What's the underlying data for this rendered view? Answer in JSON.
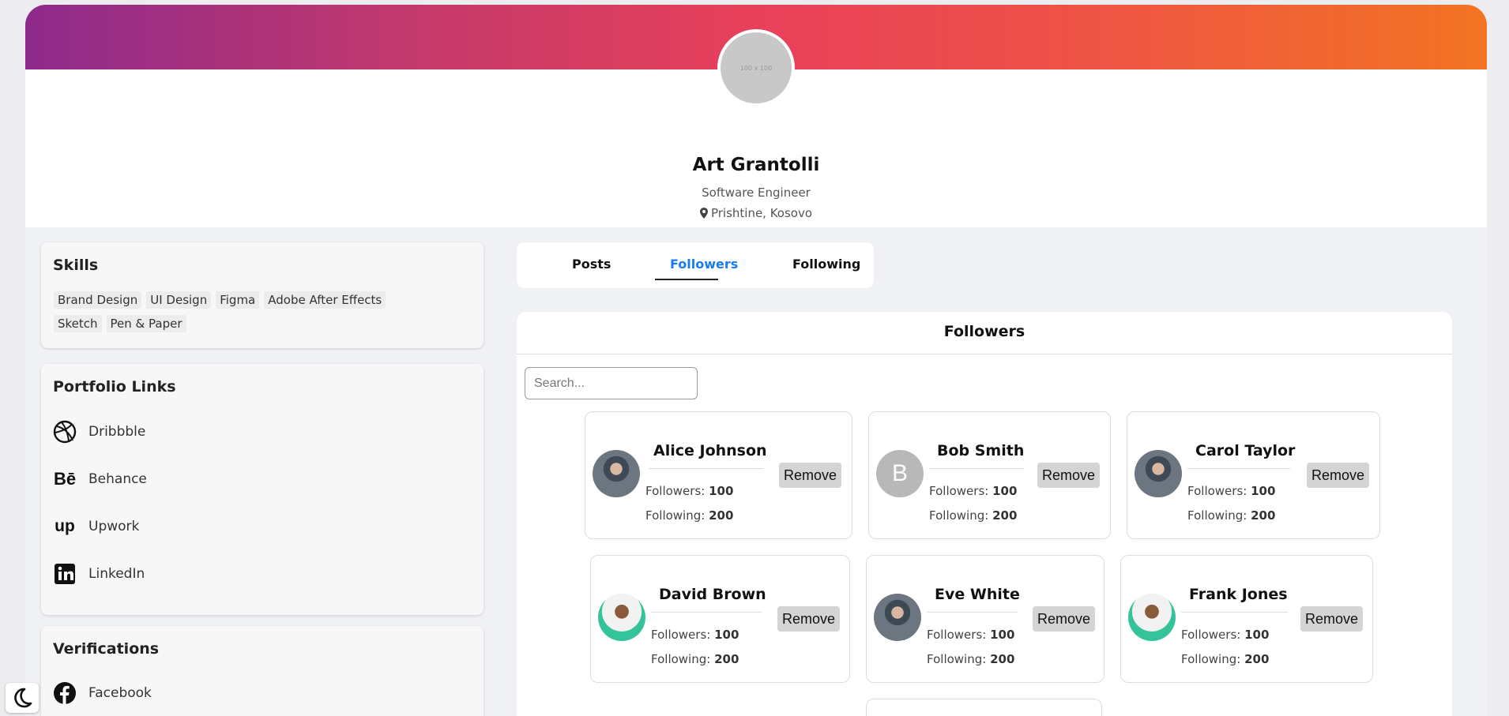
{
  "profile": {
    "avatar_placeholder": "100 x 100",
    "name": "Art Grantolli",
    "title": "Software Engineer",
    "location": "Prishtine, Kosovo"
  },
  "skills": {
    "heading": "Skills",
    "items": [
      "Brand Design",
      "UI Design",
      "Figma",
      "Adobe After Effects",
      "Sketch",
      "Pen & Paper"
    ]
  },
  "portfolio": {
    "heading": "Portfolio Links",
    "links": [
      {
        "label": "Dribbble",
        "icon": "dribbble-icon"
      },
      {
        "label": "Behance",
        "icon": "behance-icon"
      },
      {
        "label": "Upwork",
        "icon": "upwork-icon"
      },
      {
        "label": "LinkedIn",
        "icon": "linkedin-icon"
      }
    ]
  },
  "verifications": {
    "heading": "Verifications",
    "links": [
      {
        "label": "Facebook",
        "icon": "facebook-icon"
      }
    ]
  },
  "tabs": [
    {
      "label": "Posts",
      "active": false
    },
    {
      "label": "Followers",
      "active": true
    },
    {
      "label": "Following",
      "active": false
    }
  ],
  "followers": {
    "heading": "Followers",
    "search_placeholder": "Search...",
    "followers_label": "Followers:",
    "following_label": "Following:",
    "remove_label": "Remove",
    "cards": [
      {
        "name": "Alice Johnson",
        "followers": "100",
        "following": "200",
        "avatar": "photo-man-1"
      },
      {
        "name": "Bob Smith",
        "followers": "100",
        "following": "200",
        "avatar": "initial",
        "initial": "B"
      },
      {
        "name": "Carol Taylor",
        "followers": "100",
        "following": "200",
        "avatar": "photo-man-1"
      },
      {
        "name": "David Brown",
        "followers": "100",
        "following": "200",
        "avatar": "photo-man-2"
      },
      {
        "name": "Eve White",
        "followers": "100",
        "following": "200",
        "avatar": "photo-man-1"
      },
      {
        "name": "Frank Jones",
        "followers": "100",
        "following": "200",
        "avatar": "photo-man-2"
      }
    ]
  },
  "theme_toggle": {
    "icon": "moon-icon"
  }
}
